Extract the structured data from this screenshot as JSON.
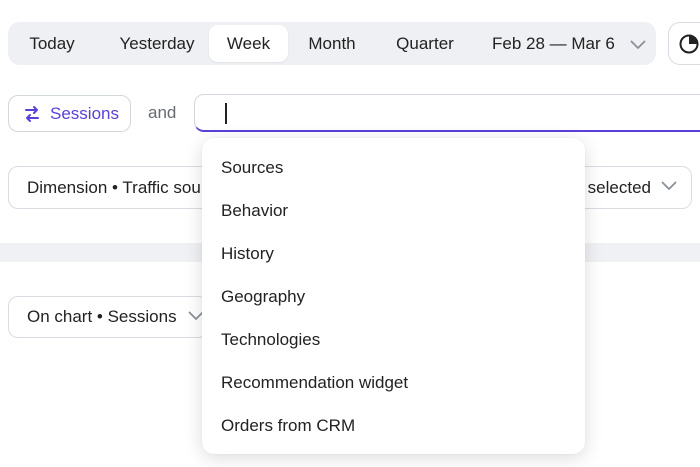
{
  "period_bar": {
    "items": [
      {
        "label": "Today",
        "active": false
      },
      {
        "label": "Yesterday",
        "active": false
      },
      {
        "label": "Week",
        "active": true
      },
      {
        "label": "Month",
        "active": false
      },
      {
        "label": "Quarter",
        "active": false
      }
    ],
    "date_range": "Feb 28 — Mar 6"
  },
  "segment": {
    "chip_label": "Sessions",
    "connector": "and",
    "search_value": ""
  },
  "dimension": {
    "label": "Dimension • Traffic source",
    "selected_label": "selected"
  },
  "chart": {
    "on_chart_label": "On chart • Sessions"
  },
  "dropdown": {
    "items": [
      "Sources",
      "Behavior",
      "History",
      "Geography",
      "Technologies",
      "Recommendation widget",
      "Orders from CRM"
    ]
  },
  "colors": {
    "accent": "#5b3fd8",
    "period_bg": "#eef0f3",
    "band": "#f0f1f4"
  }
}
